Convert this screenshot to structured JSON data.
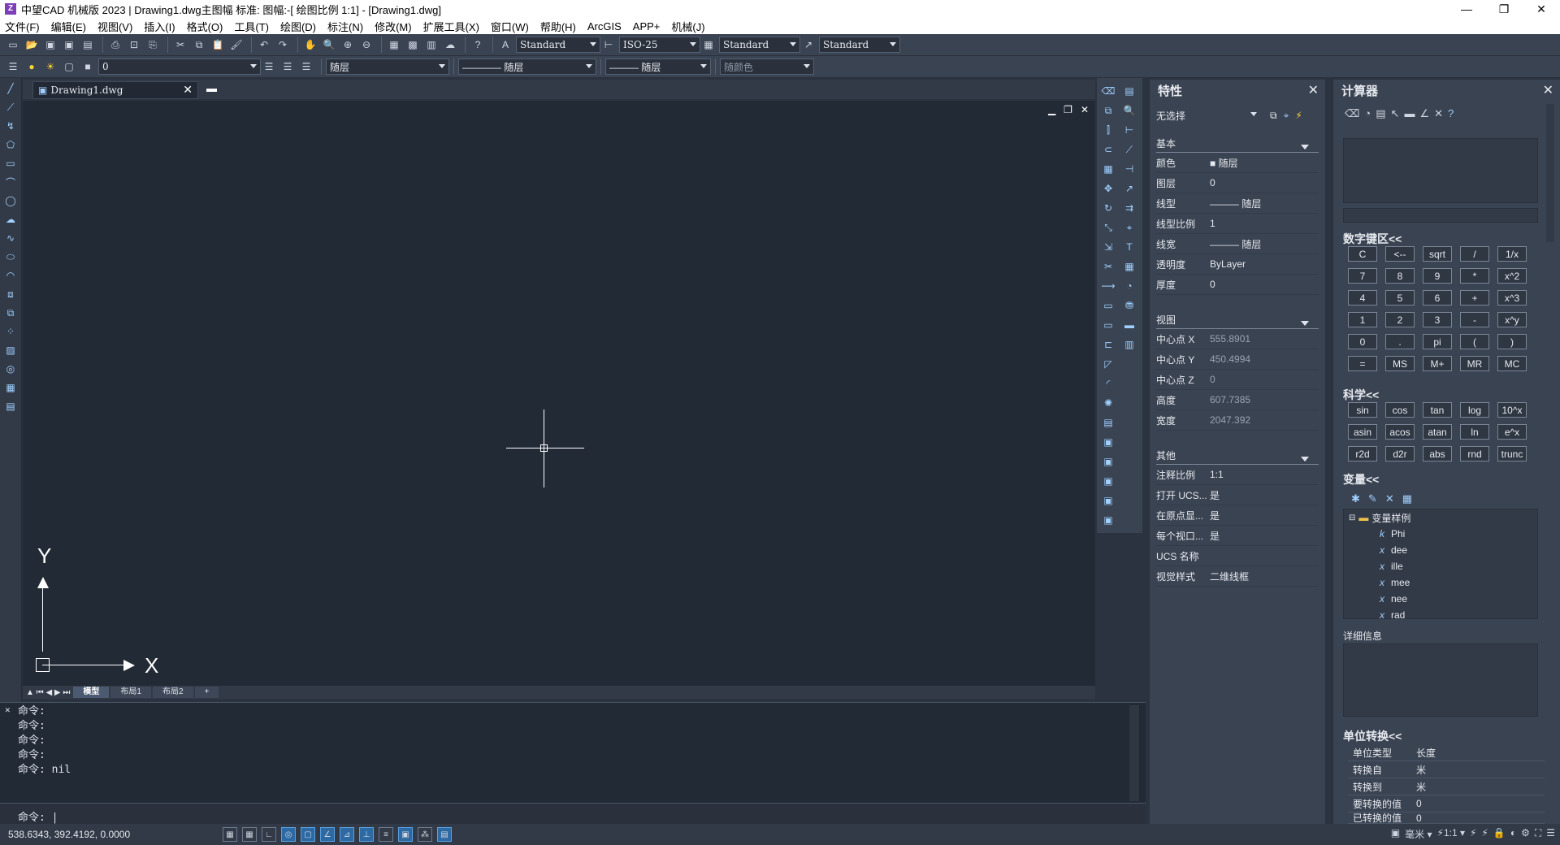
{
  "titlebar": {
    "app_icon": "Z",
    "title": "中望CAD 机械版 2023 | Drawing1.dwg主图幅  标准: 图幅:-[ 绘图比例 1:1] - [Drawing1.dwg]",
    "minimize": "—",
    "maximize": "❐",
    "close": "✕"
  },
  "menu": [
    "文件(F)",
    "编辑(E)",
    "视图(V)",
    "插入(I)",
    "格式(O)",
    "工具(T)",
    "绘图(D)",
    "标注(N)",
    "修改(M)",
    "扩展工具(X)",
    "窗口(W)",
    "帮助(H)",
    "ArcGIS",
    "APP+",
    "机械(J)"
  ],
  "toolbar1": {
    "text_style": "Standard",
    "dim_style": "ISO-25",
    "table_style": "Standard",
    "mleader_style": "Standard"
  },
  "toolbar2": {
    "layer": "0",
    "color": "随层",
    "linetype": "———— 随层",
    "lineweight": "——— 随层",
    "plotstyle": "随颜色"
  },
  "doc_tab": {
    "name": "Drawing1.dwg",
    "close": "✕"
  },
  "canvas": {
    "ucs_x": "X",
    "ucs_y": "Y"
  },
  "layout_tabs": [
    "模型",
    "布局1",
    "布局2",
    "+"
  ],
  "command": {
    "history": [
      "命令:",
      "命令:",
      "命令:",
      "命令:",
      "命令: nil"
    ],
    "prompt": "命令: |"
  },
  "status": {
    "coords": "538.6343,  392.4192,  0.0000"
  },
  "properties": {
    "title": "特性",
    "selection": "无选择",
    "sections": {
      "basic": {
        "title": "基本",
        "rows": [
          {
            "k": "颜色",
            "v": "■ 随层"
          },
          {
            "k": "图层",
            "v": "0"
          },
          {
            "k": "线型",
            "v": "——— 随层"
          },
          {
            "k": "线型比例",
            "v": "1"
          },
          {
            "k": "线宽",
            "v": "——— 随层"
          },
          {
            "k": "透明度",
            "v": "ByLayer"
          },
          {
            "k": "厚度",
            "v": "0"
          }
        ]
      },
      "view": {
        "title": "视图",
        "rows": [
          {
            "k": "中心点 X",
            "v": "555.8901"
          },
          {
            "k": "中心点 Y",
            "v": "450.4994"
          },
          {
            "k": "中心点 Z",
            "v": "0"
          },
          {
            "k": "高度",
            "v": "607.7385"
          },
          {
            "k": "宽度",
            "v": "2047.392"
          }
        ]
      },
      "misc": {
        "title": "其他",
        "rows": [
          {
            "k": "注释比例",
            "v": "1:1"
          },
          {
            "k": "打开 UCS...",
            "v": "是"
          },
          {
            "k": "在原点显...",
            "v": "是"
          },
          {
            "k": "每个视口...",
            "v": "是"
          },
          {
            "k": "UCS 名称",
            "v": ""
          },
          {
            "k": "视觉样式",
            "v": "二维线框"
          }
        ]
      }
    }
  },
  "calculator": {
    "title": "计算器",
    "numpad_title": "数字键区<<",
    "numpad": [
      "C",
      "<--",
      "sqrt",
      "/",
      "1/x",
      "7",
      "8",
      "9",
      "*",
      "x^2",
      "4",
      "5",
      "6",
      "+",
      "x^3",
      "1",
      "2",
      "3",
      "-",
      "x^y",
      "0",
      ".",
      "pi",
      "(",
      ")",
      "=",
      "MS",
      "M+",
      "MR",
      "MC"
    ],
    "sci_title": "科学<<",
    "sci": [
      "sin",
      "cos",
      "tan",
      "log",
      "10^x",
      "asin",
      "acos",
      "atan",
      "ln",
      "e^x",
      "r2d",
      "d2r",
      "abs",
      "rnd",
      "trunc"
    ],
    "var_title": "变量<<",
    "var_root": "变量样例",
    "vars": [
      {
        "type": "k",
        "name": "Phi"
      },
      {
        "type": "x",
        "name": "dee"
      },
      {
        "type": "x",
        "name": "ille"
      },
      {
        "type": "x",
        "name": "mee"
      },
      {
        "type": "x",
        "name": "nee"
      },
      {
        "type": "x",
        "name": "rad"
      }
    ],
    "detail_title": "详细信息",
    "unit_title": "单位转换<<",
    "units": [
      {
        "k": "单位类型",
        "v": "长度"
      },
      {
        "k": "转换自",
        "v": "米"
      },
      {
        "k": "转换到",
        "v": "米"
      },
      {
        "k": "要转换的值",
        "v": "0"
      },
      {
        "k": "已转换的值",
        "v": "0"
      }
    ]
  }
}
